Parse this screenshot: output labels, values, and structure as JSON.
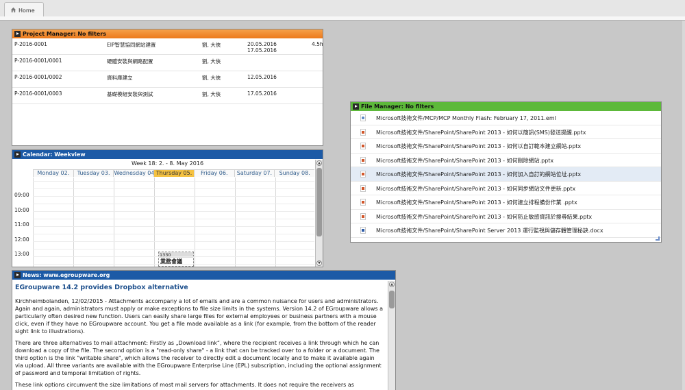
{
  "tab": {
    "home_label": "Home"
  },
  "project_manager": {
    "title": "Project Manager: No filters",
    "rows": [
      {
        "id": "P-2016-0001",
        "name": "EIP智慧協同網站建置",
        "owner": "劉, 大俠",
        "date1": "20.05.2016",
        "date2": "17.05.2016",
        "extra": "4.5h"
      },
      {
        "id": "P-2016-0001/0001",
        "name": "硬體安裝與網路配置",
        "owner": "劉, 大俠",
        "date1": "",
        "date2": "",
        "extra": ""
      },
      {
        "id": "P-2016-0001/0002",
        "name": "資料庫建立",
        "owner": "劉, 大俠",
        "date1": "12.05.2016",
        "date2": "",
        "extra": ""
      },
      {
        "id": "P-2016-0001/0003",
        "name": "基礎模組安裝與測試",
        "owner": "劉, 大俠",
        "date1": "17.05.2016",
        "date2": "",
        "extra": ""
      }
    ]
  },
  "calendar": {
    "title": "Calendar: Weekview",
    "week_title": "Week 18: 2. - 8. May 2016",
    "days": [
      "Monday 02.",
      "Tuesday 03.",
      "Wednesday 04.",
      "Thursday 05.",
      "Friday 06.",
      "Saturday 07.",
      "Sunday 08."
    ],
    "today_index": 3,
    "hours": [
      "09:00",
      "10:00",
      "11:00",
      "12:00",
      "13:00"
    ],
    "event": {
      "time": "1330",
      "name": "業務會議"
    }
  },
  "news": {
    "title": "News: www.egroupware.org",
    "headline": "EGroupware 14.2 provides Dropbox alternative",
    "paragraphs": [
      "Kirchheimbolanden, 12/02/2015 -  Attachments accompany a lot of emails and are a common nuisance for users and administrators. Again and again, administrators must apply or make exceptions to file size limits in the systems. Version 14.2 of EGroupware allows a particularly often desired new function. Users can easily share large files for external employees or business partners with a mouse click, even if they have no EGroupware account. You get a file made available as a link (for example, from the bottom of the reader sight link to illustrations).",
      "There are three alternatives to mail attachment: Firstly as „Download link“, where the recipient receives a link through which he can download a copy of the file. The second option is a \"read-only share\" - a link that can be tracked over to a folder or a document. The third option is the link \"writable share\", which allows the receiver to directly edit a document locally and to make it available again via upload. All three variants are available with the EGroupware Enterprise Line (EPL) subscription, including the optional assignment of password and temporal limitation of rights.",
      "These link options circumvent the size limitations of most mail servers for attachments. It does not require the receivers as EGroupware users. So far, people often have to leave their groupware to copy data via FTP or other products on an exchange"
    ]
  },
  "file_manager": {
    "title": "File Manager: No filters",
    "selected_index": 4,
    "files": [
      {
        "name": "Microsoft技術文件/MCP/MCP Monthly Flash: February 17, 2011.eml",
        "icon": "eml-file-icon"
      },
      {
        "name": "Microsoft技術文件/SharePoint/SharePoint 2013 - 如何以簡訊(SMS)發送提醒.pptx",
        "icon": "pptx-file-icon"
      },
      {
        "name": "Microsoft技術文件/SharePoint/SharePoint 2013 - 如何以自訂範本建立網站.pptx",
        "icon": "pptx-file-icon"
      },
      {
        "name": "Microsoft技術文件/SharePoint/SharePoint 2013 - 如何刪除網站.pptx",
        "icon": "pptx-file-icon"
      },
      {
        "name": "Microsoft技術文件/SharePoint/SharePoint 2013 - 如何加入自訂的網站位址.pptx",
        "icon": "pptx-file-icon"
      },
      {
        "name": "Microsoft技術文件/SharePoint/SharePoint 2013 - 如何同步網站文件更新.pptx",
        "icon": "pptx-file-icon"
      },
      {
        "name": "Microsoft技術文件/SharePoint/SharePoint 2013 - 如何建立排程備份作業 .pptx",
        "icon": "pptx-file-icon"
      },
      {
        "name": "Microsoft技術文件/SharePoint/SharePoint 2013 - 如何防止敏感資訊於搜尋結果.pptx",
        "icon": "pptx-file-icon"
      },
      {
        "name": "Microsoft技術文件/SharePoint/SharePoint Server 2013 運行監視與儲存體管理秘訣.docx",
        "icon": "docx-file-icon"
      }
    ]
  },
  "colors": {
    "pm_header": "#ec7a1c",
    "cal_header": "#1c5aa6",
    "fm_header": "#5db93a",
    "today": "#f5c242"
  }
}
